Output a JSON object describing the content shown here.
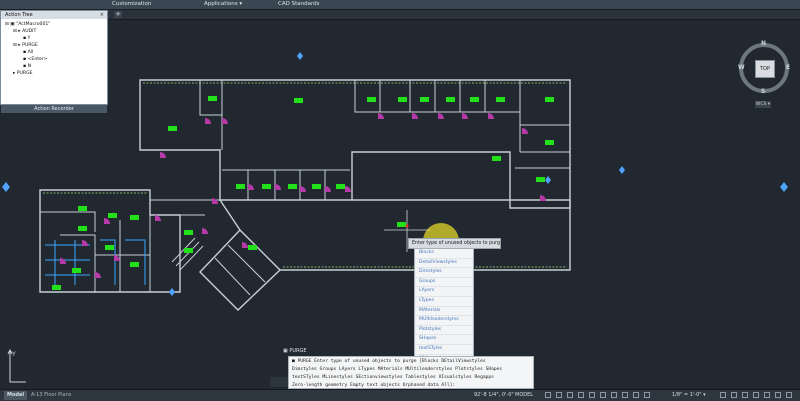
{
  "ribbon": {
    "tabs": [
      "Customization",
      "Applications ▾",
      "CAD Standards"
    ]
  },
  "action_tree": {
    "title": "Action Tree",
    "close_glyph": "×",
    "nodes": [
      "ActMacro001",
      "AUDIT",
      "Y",
      "PURGE",
      "All",
      "<Enter>",
      "N",
      "PURGE"
    ],
    "footer": "Action Recorder"
  },
  "viewcube": {
    "top": "TOP",
    "n": "N",
    "s": "S",
    "e": "E",
    "w": "W",
    "wcs": "WCS ▾"
  },
  "purge": {
    "prompt": "Enter type of unused objects to purge",
    "options": [
      "Blocks",
      "DetailViewstyles",
      "Dimstyles",
      "Groups",
      "LAyers",
      "LTypes",
      "MAterials",
      "MUltileaderstyles",
      "Plotstyles",
      "SHapes",
      "textSTyles",
      "MLinestyles",
      "SEctionviewstyles",
      "Tablestyles"
    ],
    "last_option": "Empty text objects"
  },
  "command": {
    "label": "PURGE",
    "history": [
      "■ PURGE Enter type of unused objects to purge [Blocks DEtailViewstyles",
      "Dimstyles Groups LAyers LTypes MAterials MUltileaderstyles Plotstyles SHapes",
      "textSTyles MLinestyles SEctionviewstyles Tablestyles VIsualstyles Regapps",
      "Zero-length geometry Empty text objects Orphaned data All]:"
    ]
  },
  "status": {
    "model_tab": "Model",
    "layout_tab": "A-13 Floor Plans",
    "coords": "92'-8 1/4\", 0'-0\"",
    "model": "MODEL",
    "scale": "1/8\" = 1'-0\" ▾"
  },
  "colors": {
    "background": "#212830",
    "tag": "#22e01a",
    "door": "#b53aa8",
    "highlight": "#ffee28"
  }
}
